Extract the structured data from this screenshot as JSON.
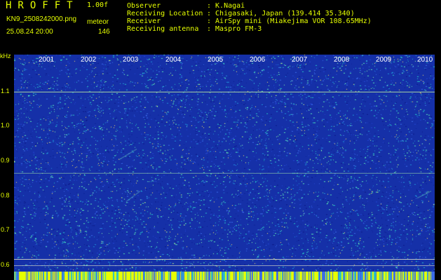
{
  "header": {
    "app_name": "HROFFT",
    "version": "1.00f",
    "filename": "KN9_2508242000.png",
    "mode": "meteor",
    "datetime": "25.08.24 20:00",
    "count": "146"
  },
  "info": [
    {
      "key": "Observer",
      "value": ": K.Nagai"
    },
    {
      "key": "Receiving Location",
      "value": ": Chigasaki, Japan (139.414 35.340)"
    },
    {
      "key": "Receiver",
      "value": ": AirSpy mini (Miakejima VOR 108.65MHz)"
    },
    {
      "key": "Receiving antenna",
      "value": ": Maspro FM-3"
    }
  ],
  "axis": {
    "unit": "kHz",
    "x_labels": [
      "2001",
      "2002",
      "2003",
      "2004",
      "2005",
      "2006",
      "2007",
      "2008",
      "2009",
      "2010"
    ],
    "y_labels": [
      "1.1",
      "1.0",
      "0.9",
      "0.8",
      "0.7",
      "0.6"
    ]
  },
  "colors": {
    "label": "#e6ff00",
    "background": "#000000",
    "plot_base": "#1530a8",
    "signal_line": "#7cff7c"
  }
}
